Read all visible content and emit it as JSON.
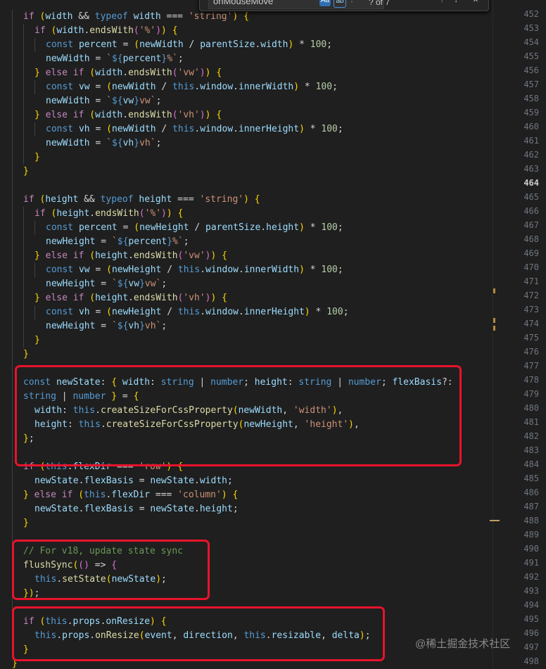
{
  "find": {
    "query": "onMouseMove",
    "match_case": "Aa",
    "whole_word": "ab",
    "count": "? of 7",
    "icon_regex": "regex-icon",
    "icon_up": "arrow-up-icon",
    "icon_down": "arrow-down-icon"
  },
  "code": [
    [
      "if (width && typeof width === 'string') {",
      1
    ],
    [
      "if (width.endsWith('%')) {",
      2
    ],
    [
      "const percent = (newWidth / parentSize.width) * 100;",
      3
    ],
    [
      "newWidth = `${percent}%`;",
      3
    ],
    [
      "} else if (width.endsWith('vw')) {",
      2
    ],
    [
      "const vw = (newWidth / this.window.innerWidth) * 100;",
      3
    ],
    [
      "newWidth = `${vw}vw`;",
      3
    ],
    [
      "} else if (width.endsWith('vh')) {",
      2
    ],
    [
      "const vh = (newWidth / this.window.innerHeight) * 100;",
      3
    ],
    [
      "newWidth = `${vh}vh`;",
      3
    ],
    [
      "}",
      2
    ],
    [
      "}",
      1
    ],
    [
      "",
      1
    ],
    [
      "if (height && typeof height === 'string') {",
      1
    ],
    [
      "if (height.endsWith('%')) {",
      2
    ],
    [
      "const percent = (newHeight / parentSize.height) * 100;",
      3
    ],
    [
      "newHeight = `${percent}%`;",
      3
    ],
    [
      "} else if (height.endsWith('vw')) {",
      2
    ],
    [
      "const vw = (newHeight / this.window.innerWidth) * 100;",
      3
    ],
    [
      "newHeight = `${vw}vw`;",
      3
    ],
    [
      "} else if (height.endsWith('vh')) {",
      2
    ],
    [
      "const vh = (newHeight / this.window.innerHeight) * 100;",
      3
    ],
    [
      "newHeight = `${vh}vh`;",
      3
    ],
    [
      "}",
      2
    ],
    [
      "}",
      1
    ],
    [
      "",
      1
    ],
    [
      "const newState: { width: string | number; height: string | number; flexBasis?:",
      1
    ],
    [
      "string | number } = {",
      1
    ],
    [
      "width: this.createSizeForCssProperty(newWidth, 'width'),",
      2
    ],
    [
      "height: this.createSizeForCssProperty(newHeight, 'height'),",
      2
    ],
    [
      "};",
      1
    ],
    [
      "",
      1
    ],
    [
      "if (this.flexDir === 'row') {",
      1
    ],
    [
      "newState.flexBasis = newState.width;",
      2
    ],
    [
      "} else if (this.flexDir === 'column') {",
      1
    ],
    [
      "newState.flexBasis = newState.height;",
      2
    ],
    [
      "}",
      1
    ],
    [
      "",
      1
    ],
    [
      "// For v18, update state sync",
      1
    ],
    [
      "flushSync(() => {",
      1
    ],
    [
      "this.setState(newState);",
      2
    ],
    [
      "});",
      1
    ],
    [
      "",
      1
    ],
    [
      "if (this.props.onResize) {",
      1
    ],
    [
      "this.props.onResize(event, direction, this.resizable, delta);",
      2
    ],
    [
      "}",
      1
    ],
    [
      "}",
      0
    ]
  ],
  "line_numbers": [
    "452",
    "453",
    "454",
    "455",
    "456",
    "457",
    "458",
    "459",
    "460",
    "461",
    "462",
    "463",
    "464",
    "465",
    "466",
    "467",
    "468",
    "469",
    "470",
    "471",
    "472",
    "473",
    "474",
    "475",
    "476",
    "477",
    "478",
    "479",
    "480",
    "481",
    "482",
    "483",
    "484",
    "485",
    "486",
    "487",
    "488",
    "489",
    "490",
    "491",
    "492",
    "493",
    "494",
    "495",
    "496",
    "497",
    "498"
  ],
  "active_line": "464",
  "watermark": "@稀土掘金技术社区",
  "colors": {
    "background": "#1f1f1f",
    "highlight_box": "#e8132c",
    "keyword": "#569cd6",
    "control": "#c586c0",
    "variable": "#9cdcfe",
    "function": "#dcdcaa",
    "string": "#ce9178",
    "number": "#b5cea8",
    "comment": "#6a9955"
  }
}
